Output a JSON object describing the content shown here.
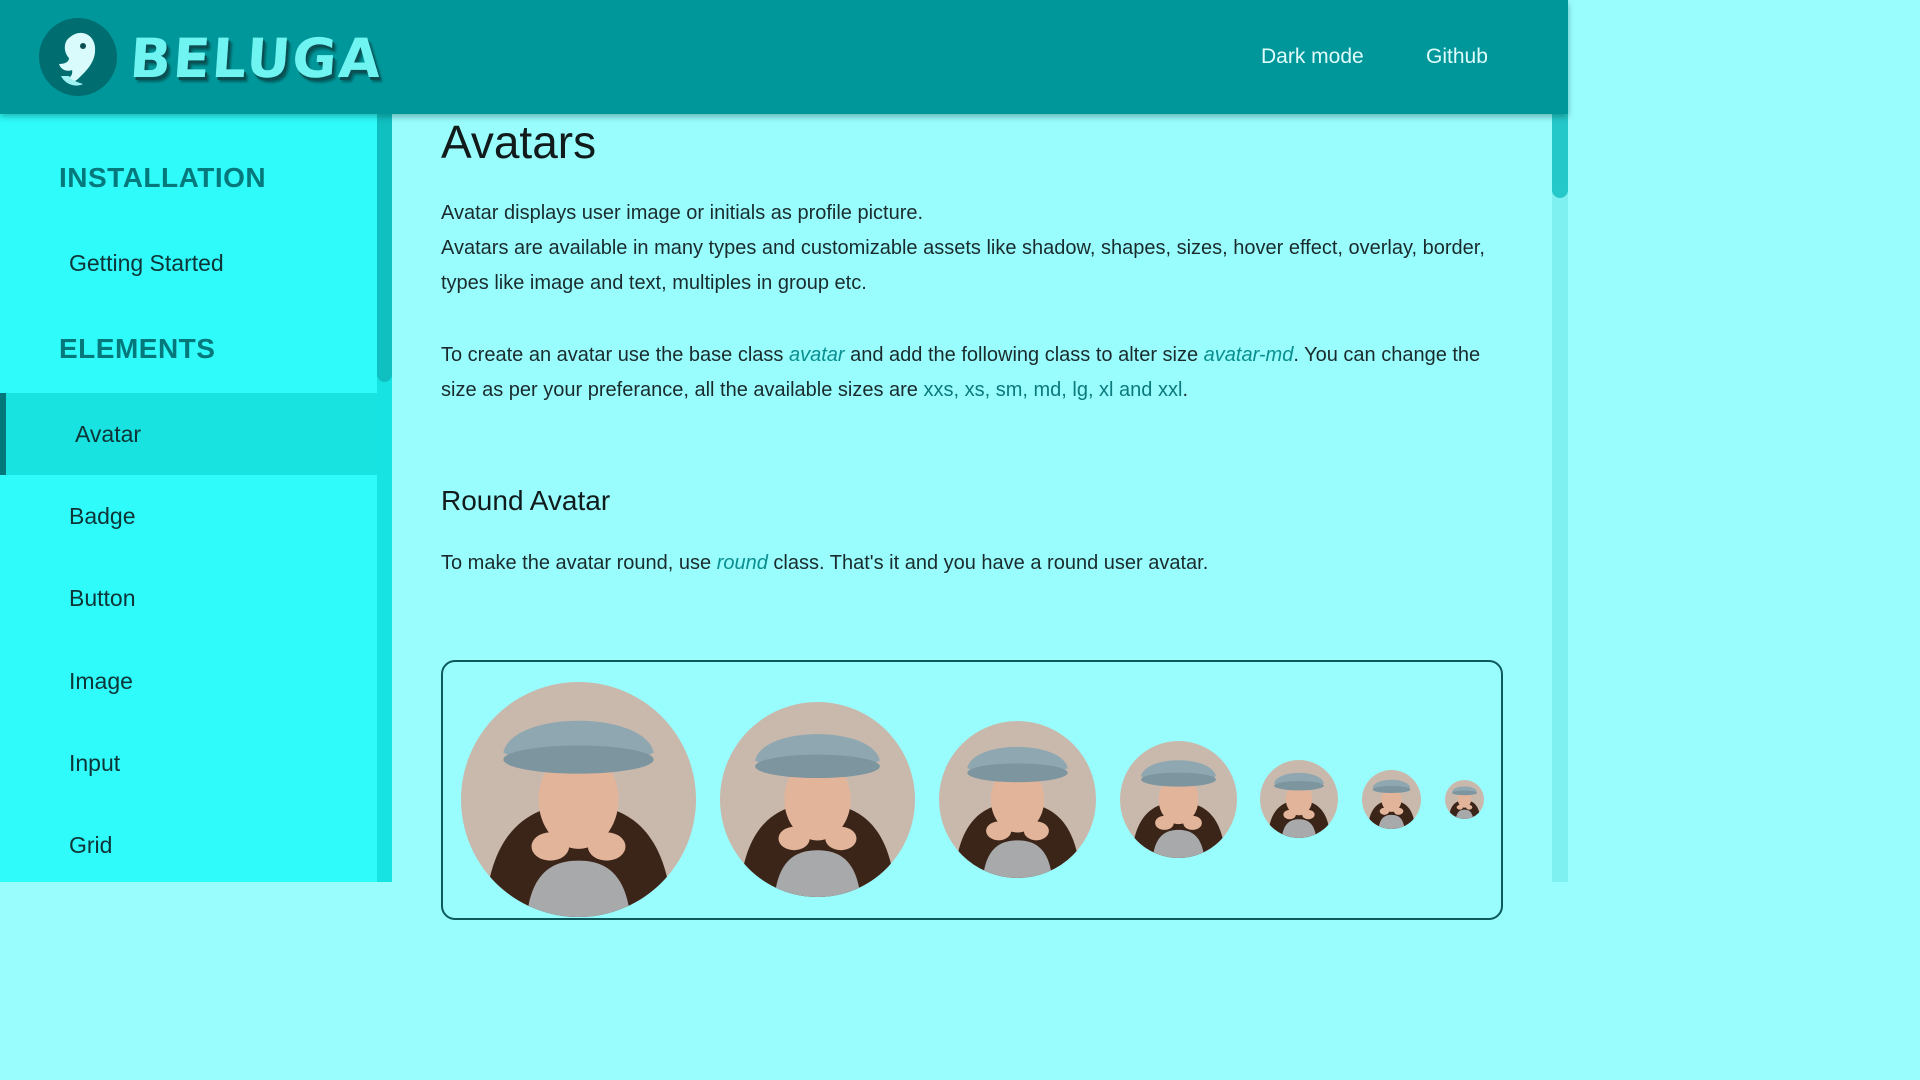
{
  "header": {
    "logo_text": "BELUGA",
    "nav": {
      "dark_mode": "Dark mode",
      "github": "Github"
    }
  },
  "sidebar": {
    "sections": [
      {
        "title": "INSTALLATION",
        "items": [
          "Getting Started"
        ]
      },
      {
        "title": "ELEMENTS",
        "items": [
          "Avatar",
          "Badge",
          "Button",
          "Image",
          "Input",
          "Grid"
        ]
      }
    ],
    "active_item": "Avatar"
  },
  "main": {
    "title": "Avatars",
    "intro_line1": "Avatar displays user image or initials as profile picture.",
    "intro_line2": "Avatars are available in many types and customizable assets like shadow, shapes, sizes, hover effect, overlay, border, types like image and text, multiples in group etc.",
    "usage": {
      "text1": "To create an avatar use the base class ",
      "code1": "avatar",
      "text2": " and add the following class to alter size ",
      "code2": "avatar-md",
      "text3": ". You can change the size as per your preferance, all the available sizes are ",
      "sizes": "xxs, xs, sm, md, lg, xl and xxl",
      "text4": "."
    },
    "round": {
      "title": "Round Avatar",
      "text1": "To make the avatar round, use ",
      "code": "round",
      "text2": " class. That's it and you have a round user avatar."
    },
    "avatar_sizes": [
      "xxl",
      "xl",
      "lg",
      "md",
      "sm",
      "xs",
      "xxs"
    ]
  },
  "colors": {
    "header": "#00979a",
    "sidebar": "#2ffcfa",
    "content": "#9afdfd",
    "accent": "#05787c"
  }
}
